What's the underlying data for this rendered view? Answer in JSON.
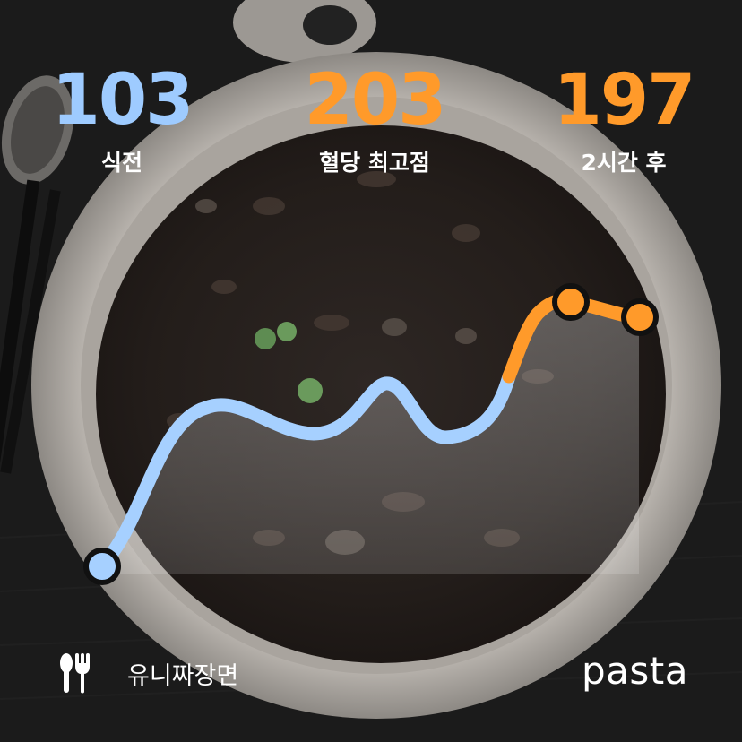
{
  "stats": {
    "before": {
      "value": "103",
      "label": "식전",
      "color": "#9ecbff"
    },
    "peak": {
      "value": "203",
      "label": "혈당 최고점",
      "color": "#ff9a2a"
    },
    "after": {
      "value": "197",
      "label": "2시간 후",
      "color": "#ff9a2a"
    }
  },
  "food": {
    "name": "유니짜장면",
    "icon": "utensils-icon"
  },
  "brand": {
    "name": "pasta"
  },
  "colors": {
    "normal_line": "#a6d0ff",
    "high_line": "#ff9a2a",
    "marker_outline": "#111111"
  }
}
